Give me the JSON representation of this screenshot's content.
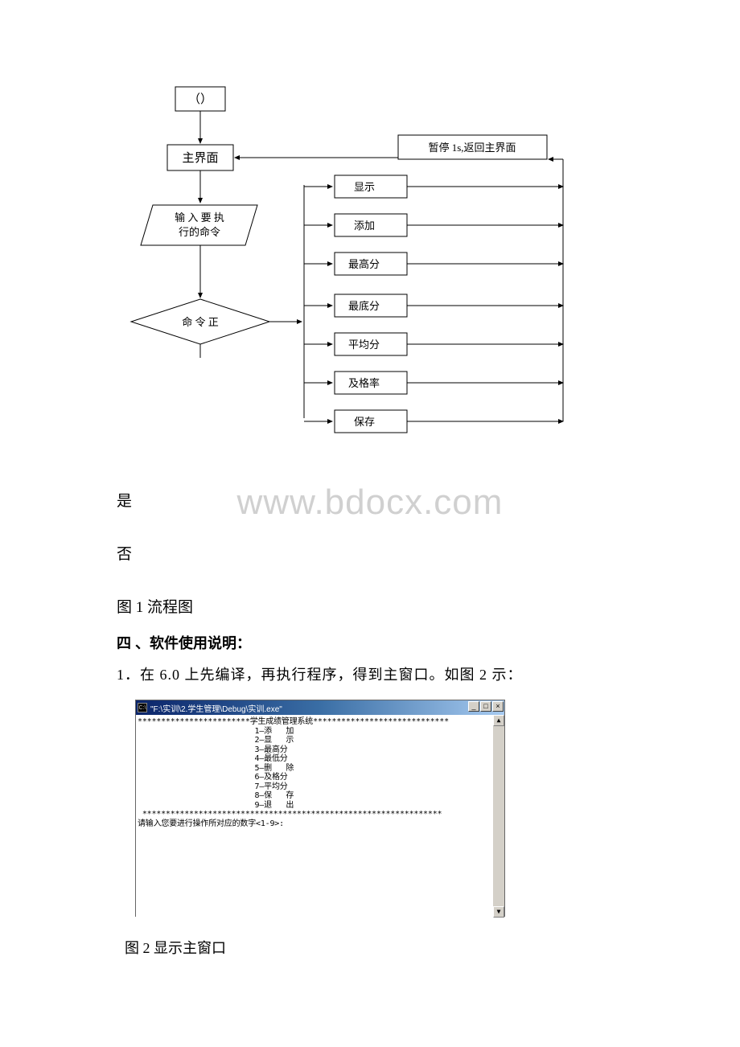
{
  "flowchart": {
    "start": "（）",
    "main_ui": "主界面",
    "input_cmd_line1": "输 入 要 执",
    "input_cmd_line2": "行的命令",
    "check_cmd": "命 令 正",
    "pause_return": "暂停 1s,返回主界面",
    "actions": [
      "显示",
      "添加",
      "最高分",
      "最底分",
      "平均分",
      "及格率",
      "保存"
    ]
  },
  "labels": {
    "yes": "是",
    "no": "否",
    "caption1": "图 1 流程图",
    "section_title": "四 、软件使用说明：",
    "instruction": "1．在 6.0 上先编译，再执行程序，得到主窗口。如图 2 示：",
    "caption2": "图 2 显示主窗口"
  },
  "watermark": "www.bdocx.com",
  "console": {
    "title": "\"F:\\实训\\2.学生管理\\Debug\\实训.exe\"",
    "icon_text": "C:\\",
    "header": "************************学生成绩管理系统*****************************",
    "menu": [
      "                         1—添   加",
      "                         2—显   示",
      "                         3—最高分",
      "                         4—最低分",
      "                         5—删   除",
      "                         6—及格分",
      "                         7—平均分",
      "                         8—保   存",
      "                         9—退   出"
    ],
    "divider": " ****************************************************************",
    "prompt": "请输入您要进行操作所对应的数字<1-9>:"
  },
  "win_buttons": {
    "min": "_",
    "max": "□",
    "close": "×"
  },
  "scroll": {
    "up": "▲",
    "down": "▼"
  }
}
